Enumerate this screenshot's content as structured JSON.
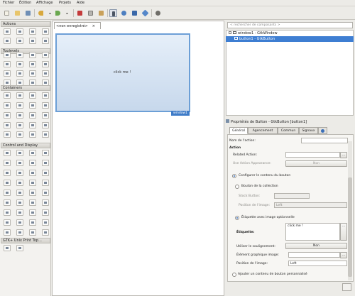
{
  "menu": [
    "Fichier",
    "Édition",
    "Affichage",
    "Projets",
    "Aide"
  ],
  "toolbar": {
    "buttons": [
      "new-icon",
      "open-icon",
      "save-icon",
      "undo-icon",
      "redo-icon",
      "cut-icon",
      "copy-icon",
      "paste-icon",
      "select-icon",
      "move-icon",
      "insert-icon",
      "palette-icon"
    ]
  },
  "palette": {
    "categories": [
      "Actions",
      "Toplevels",
      "Containers",
      "Control and Display",
      "GTK+ Unix Print Top..."
    ]
  },
  "design": {
    "tab_label": "<non enregistré>",
    "button_text": "click me !",
    "window_label": "window1"
  },
  "inspector": {
    "search_placeholder": "< rechercher de composants >",
    "tree": [
      {
        "label": "window1 - GtkWindow"
      },
      {
        "label": "button1 - GtkButton",
        "selected": true
      }
    ]
  },
  "properties": {
    "header": "Propriétés de Button - GtkButton [button1]",
    "tabs": [
      "Général",
      "Agencement",
      "Commun",
      "Signaux"
    ],
    "accessibility_icon": "accessibility-icon",
    "name_label": "Nom de l'action:",
    "action_heading": "Action",
    "related_action": "Related Action:",
    "use_action_appearance": "Use Action Appearance:",
    "use_action_appearance_value": "Non",
    "configure_content": "Configurer le contenu du bouton",
    "stock_button": "Bouton de la collection",
    "stock_button_label": "Stock Button:",
    "image_position_label": "Position de l'image:",
    "image_position_value": "Left",
    "label_with_image": "Étiquette avec image optionnelle",
    "label_label": "Étiquette:",
    "label_value": "click me !",
    "use_underline": "Utiliser le soulignement:",
    "use_underline_value": "Non",
    "image_widget": "Élément graphique image:",
    "image_position2_label": "Position de l'image:",
    "image_position2_value": "Left",
    "custom_content": "Ajouter un contenu de bouton personnalisé"
  }
}
